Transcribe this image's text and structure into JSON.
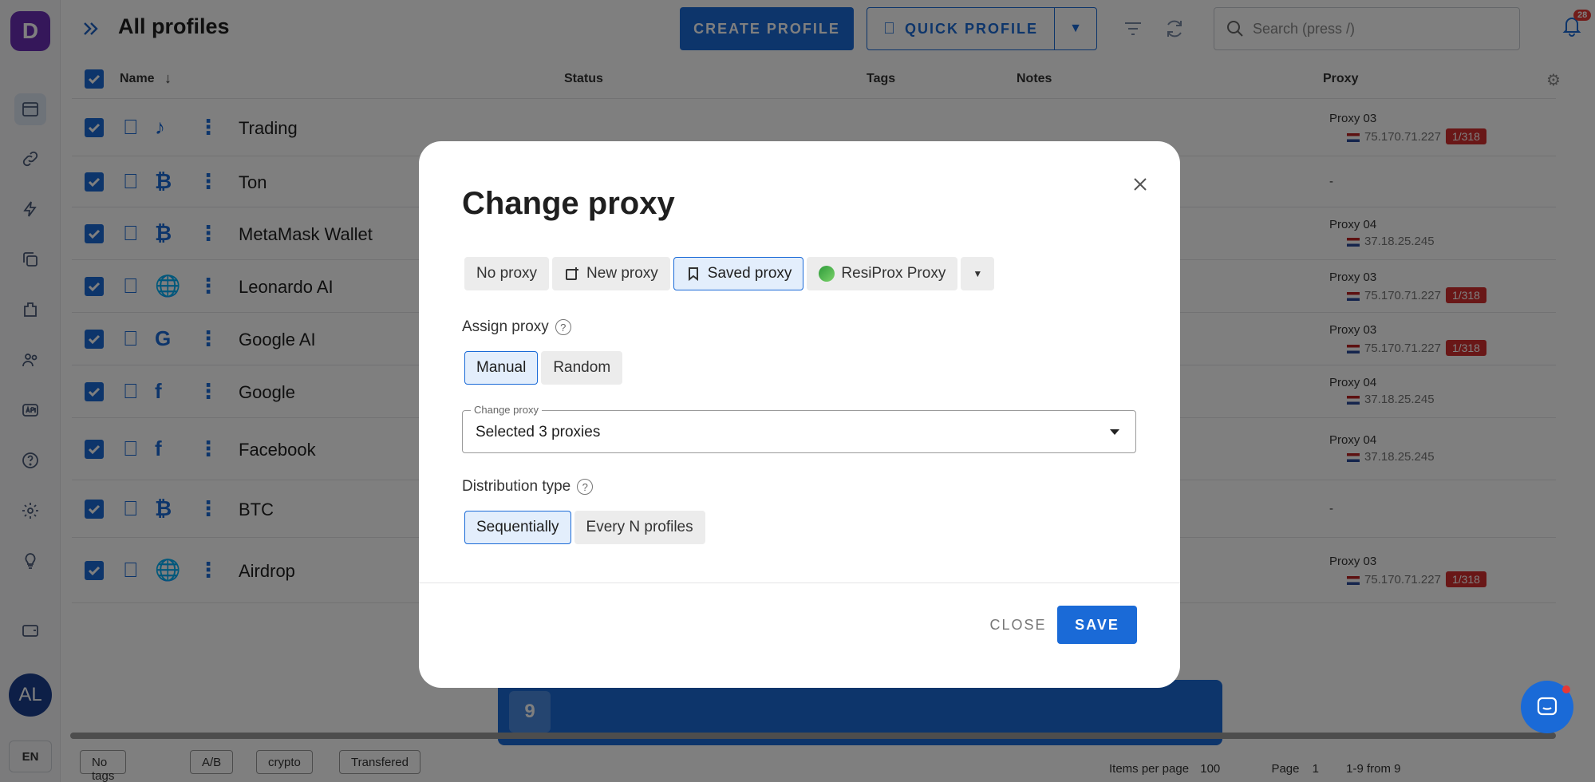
{
  "app": {
    "logo_letter": "D",
    "page_title": "All profiles",
    "avatar_initials": "AL",
    "language": "EN",
    "notifications_count": "28"
  },
  "toolbar": {
    "create_profile": "CREATE PROFILE",
    "quick_profile": "QUICK PROFILE",
    "search_placeholder": "Search (press /)"
  },
  "table": {
    "columns": {
      "name": "Name",
      "status": "Status",
      "tags": "Tags",
      "notes": "Notes",
      "proxy": "Proxy"
    },
    "rows": [
      {
        "name": "Trading",
        "proxy_name": "Proxy 03",
        "proxy_ip": "75.170.71.227",
        "limit": "1/318"
      },
      {
        "name": "Ton",
        "proxy_name": "-",
        "proxy_ip": "",
        "limit": ""
      },
      {
        "name": "MetaMask Wallet",
        "proxy_name": "Proxy 04",
        "proxy_ip": "37.18.25.245",
        "limit": ""
      },
      {
        "name": "Leonardo AI",
        "proxy_name": "Proxy 03",
        "proxy_ip": "75.170.71.227",
        "limit": "1/318"
      },
      {
        "name": "Google AI",
        "proxy_name": "Proxy 03",
        "proxy_ip": "75.170.71.227",
        "limit": "1/318"
      },
      {
        "name": "Google",
        "proxy_name": "Proxy 04",
        "proxy_ip": "37.18.25.245",
        "limit": ""
      },
      {
        "name": "Facebook",
        "proxy_name": "Proxy 04",
        "proxy_ip": "37.18.25.245",
        "limit": ""
      },
      {
        "name": "BTC",
        "proxy_name": "-",
        "proxy_ip": "",
        "limit": ""
      },
      {
        "name": "Airdrop",
        "proxy_name": "Proxy 03",
        "proxy_ip": "75.170.71.227",
        "limit": "1/318"
      }
    ],
    "row_icons": [
      "tiktok-icon",
      "bitcoin-icon",
      "bitcoin-icon",
      "globe-icon",
      "google-icon",
      "facebook-icon",
      "facebook-icon",
      "bitcoin-icon",
      "globe-icon"
    ]
  },
  "bottom": {
    "tag_chips": [
      "No tags",
      "A/B",
      "crypto",
      "Transfered"
    ],
    "items_per_page_label": "Items per page",
    "items_per_page": "100",
    "page_label": "Page",
    "page": "1",
    "range": "1-9 from 9"
  },
  "action_bar": {
    "selected_count": "9"
  },
  "modal": {
    "title": "Change proxy",
    "proxy_source_options": [
      "No proxy",
      "New proxy",
      "Saved proxy",
      "ResiProx Proxy"
    ],
    "proxy_source_selected": "Saved proxy",
    "assign_proxy_label": "Assign proxy",
    "assign_options": [
      "Manual",
      "Random"
    ],
    "assign_selected": "Manual",
    "change_proxy_legend": "Change proxy",
    "change_proxy_value": "Selected 3 proxies",
    "distribution_label": "Distribution type",
    "distribution_options": [
      "Sequentially",
      "Every N profiles"
    ],
    "distribution_selected": "Sequentially",
    "close_label": "CLOSE",
    "save_label": "SAVE"
  },
  "colors": {
    "accent": "#1a6ad7",
    "danger": "#d32f2f",
    "brand": "#6b2fb5"
  }
}
